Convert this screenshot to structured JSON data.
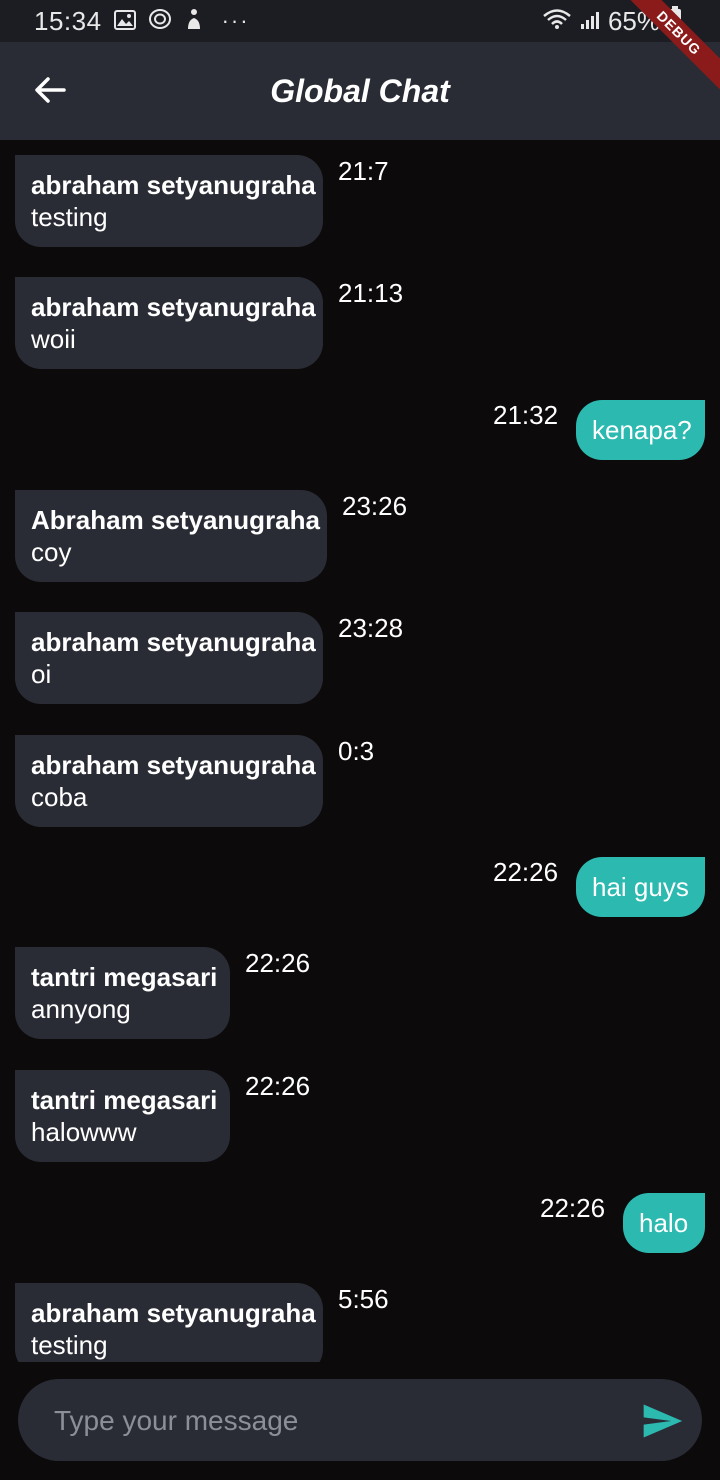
{
  "status_bar": {
    "time": "15:34",
    "battery": "65%",
    "overflow": "···",
    "icons": [
      "gallery-icon",
      "sync-icon",
      "accessibility-icon",
      "wifi-icon",
      "signal-icon",
      "battery-icon"
    ]
  },
  "app_bar": {
    "title": "Global Chat",
    "back_icon": "arrow-left-icon",
    "debug_banner": "DEBUG"
  },
  "colors": {
    "background": "#0c0a0a",
    "app_bar": "#2a2c35",
    "incoming_bubble": "#2a2c35",
    "outgoing_bubble": "#2bb9b0",
    "send_icon": "#2bb9b0"
  },
  "messages": [
    {
      "direction": "incoming",
      "sender": "abraham setyanugraha",
      "text": "testing",
      "time": "21:7"
    },
    {
      "direction": "incoming",
      "sender": "abraham setyanugraha",
      "text": "woii",
      "time": "21:13"
    },
    {
      "direction": "outgoing",
      "text": "kenapa?",
      "time": "21:32"
    },
    {
      "direction": "incoming",
      "sender": "Abraham setyanugraha",
      "text": "coy",
      "time": "23:26"
    },
    {
      "direction": "incoming",
      "sender": "abraham setyanugraha",
      "text": "oi",
      "time": "23:28"
    },
    {
      "direction": "incoming",
      "sender": "abraham setyanugraha",
      "text": "coba",
      "time": "0:3"
    },
    {
      "direction": "outgoing",
      "text": "hai guys",
      "time": "22:26"
    },
    {
      "direction": "incoming",
      "sender": "tantri megasari",
      "text": "annyong",
      "time": "22:26"
    },
    {
      "direction": "incoming",
      "sender": "tantri megasari",
      "text": "halowww",
      "time": "22:26"
    },
    {
      "direction": "outgoing",
      "text": "halo",
      "time": "22:26"
    },
    {
      "direction": "incoming",
      "sender": "abraham setyanugraha",
      "text": "testing",
      "time": "5:56"
    }
  ],
  "composer": {
    "placeholder": "Type your message",
    "value": "",
    "send_icon": "send-icon"
  }
}
